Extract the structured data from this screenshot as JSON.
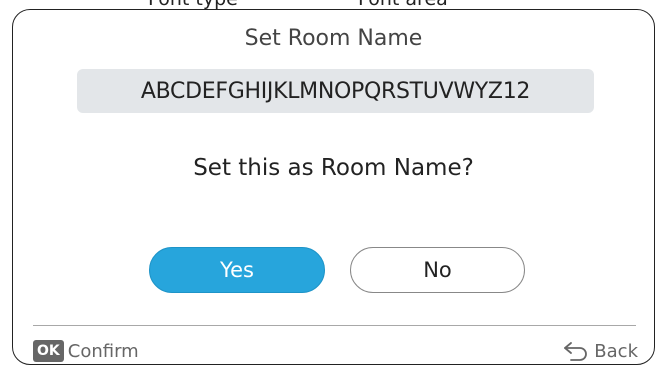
{
  "header_labels": {
    "font_type": "Font type",
    "font_area": "Font area"
  },
  "dialog": {
    "title": "Set Room Name",
    "room_name_value": "ABCDEFGHIJKLMNOPQRSTUVWYZ12",
    "question": "Set this as Room Name?",
    "yes_label": "Yes",
    "no_label": "No"
  },
  "footer": {
    "ok_badge": "OK",
    "confirm_label": "Confirm",
    "back_label": "Back",
    "back_icon": "return-arrow-icon"
  },
  "colors": {
    "accent": "#27a5dc",
    "name_box_bg": "#e3e6e9"
  }
}
